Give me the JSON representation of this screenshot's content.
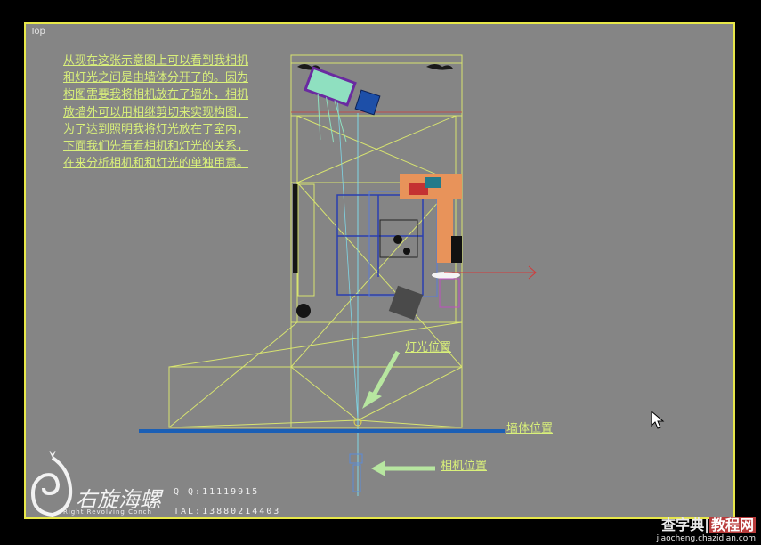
{
  "viewport": {
    "label": "Top"
  },
  "caption_lines": [
    "从现在这张示意图上可以看到我相机",
    "和灯光之间是由墙体分开了的。因为",
    "构图需要我将相机放在了墙外，相机",
    "放墙外可以用相继剪切来实现构图，",
    "为了达到照明我将灯光放在了室内，",
    "下面我们先看看相机和灯光的关系，",
    "在来分析相机和和灯光的单独用意。"
  ],
  "annotations": {
    "light": "灯光位置",
    "wall": "墙体位置",
    "camera": "相机位置"
  },
  "logo": {
    "brand": "右旋海螺",
    "sub": "Right Revolving Conch",
    "qq": "Q Q:11119915",
    "tel": "TAL:13880214403"
  },
  "watermark": {
    "line1": "查字典",
    "line1b": "教程网",
    "line2": "jiaocheng.chazidian.com"
  },
  "colors": {
    "viewport_bg": "#858585",
    "frame": "#e8e84a",
    "caption": "#d9f07a",
    "wall": "#1b5fb5"
  }
}
